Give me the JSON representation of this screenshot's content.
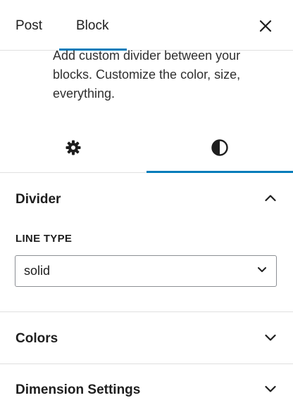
{
  "header": {
    "tabs": [
      {
        "label": "Post"
      },
      {
        "label": "Block"
      }
    ],
    "close_icon": "close-icon"
  },
  "block": {
    "description": "Add custom divider between your blocks. Customize the color, size, everything."
  },
  "subtabs": {
    "settings_icon": "gear-icon",
    "styles_icon": "contrast-icon",
    "active": "styles"
  },
  "divider_panel": {
    "title": "Divider",
    "expanded": true,
    "line_type_label": "LINE TYPE",
    "line_type_value": "solid"
  },
  "colors_panel": {
    "title": "Colors",
    "expanded": false
  },
  "dimensions_panel": {
    "title": "Dimension Settings",
    "expanded": false
  },
  "theme": {
    "accent": "#007cba",
    "border": "#e0e0e0",
    "text": "#1e1e1e"
  }
}
